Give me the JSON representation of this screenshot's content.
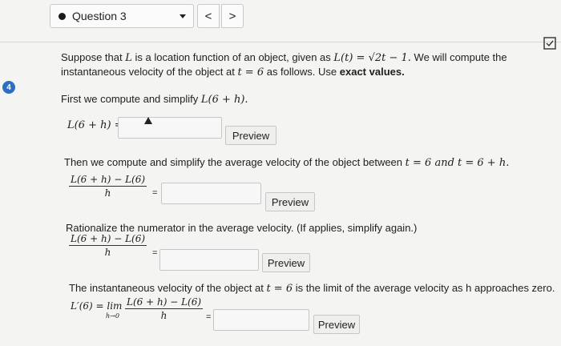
{
  "header": {
    "question_label": "Question 3",
    "prev_symbol": "<",
    "next_symbol": ">"
  },
  "question_number": "4",
  "problem": {
    "intro_pre": "Suppose that",
    "intro_L": "L",
    "intro_mid": "is a location function of an object, given as",
    "intro_fx": "L(t) = √2t − 1.",
    "intro_post": "We will compute the",
    "line2": "instantaneous velocity of the object at",
    "line2_math": "t = 6",
    "line2_post": "as follows. Use",
    "line2_bold": "exact values.",
    "step1_text": "First we compute and simplify",
    "step1_math": "L(6 + h).",
    "step1_label": "L(6 + h) =",
    "step2_text": "Then we compute and simplify the average velocity of the object between",
    "step2_math": "t = 6 and t = 6 + h.",
    "step3_text": "Rationalize the numerator in the average velocity. (If applies, simplify again.)",
    "step4_text": "The instantaneous velocity of the object at",
    "step4_math": "t = 6",
    "step4_post": "is the limit of the average velocity as h approaches zero.",
    "frac_num": "L(6 + h) − L(6)",
    "frac_den": "h",
    "limit_label": "L′(6) = lim",
    "limit_sub": "h→0",
    "equals": "="
  },
  "preview_label": "Preview"
}
